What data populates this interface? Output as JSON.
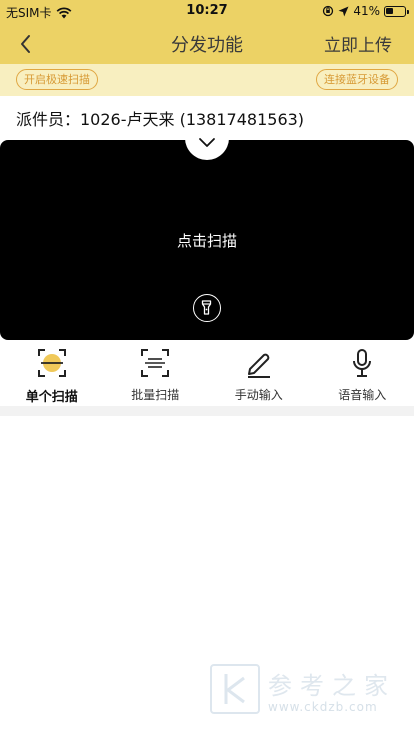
{
  "status_bar": {
    "carrier": "无SIM卡",
    "time": "10:27",
    "battery": "41%",
    "battery_fraction": 0.41
  },
  "navbar": {
    "title": "分发功能",
    "action": "立即上传"
  },
  "options": {
    "fast_scan": "开启极速扫描",
    "bluetooth": "连接蓝牙设备"
  },
  "courier": {
    "label": "派件员：1026-卢天来 (13817481563)"
  },
  "scanner": {
    "prompt": "点击扫描"
  },
  "tabs": [
    {
      "label": "单个扫描",
      "icon": "single-scan-icon",
      "active": true
    },
    {
      "label": "批量扫描",
      "icon": "batch-scan-icon",
      "active": false
    },
    {
      "label": "手动输入",
      "icon": "pen-icon",
      "active": false
    },
    {
      "label": "语音输入",
      "icon": "microphone-icon",
      "active": false
    }
  ],
  "watermark": {
    "title": "参考之家",
    "url": "www.ckdzb.com"
  },
  "colors": {
    "header": "#ecd265",
    "option_bar": "#f8efc0",
    "pill_accent": "#e0a743",
    "scanner_bg": "#000000"
  }
}
